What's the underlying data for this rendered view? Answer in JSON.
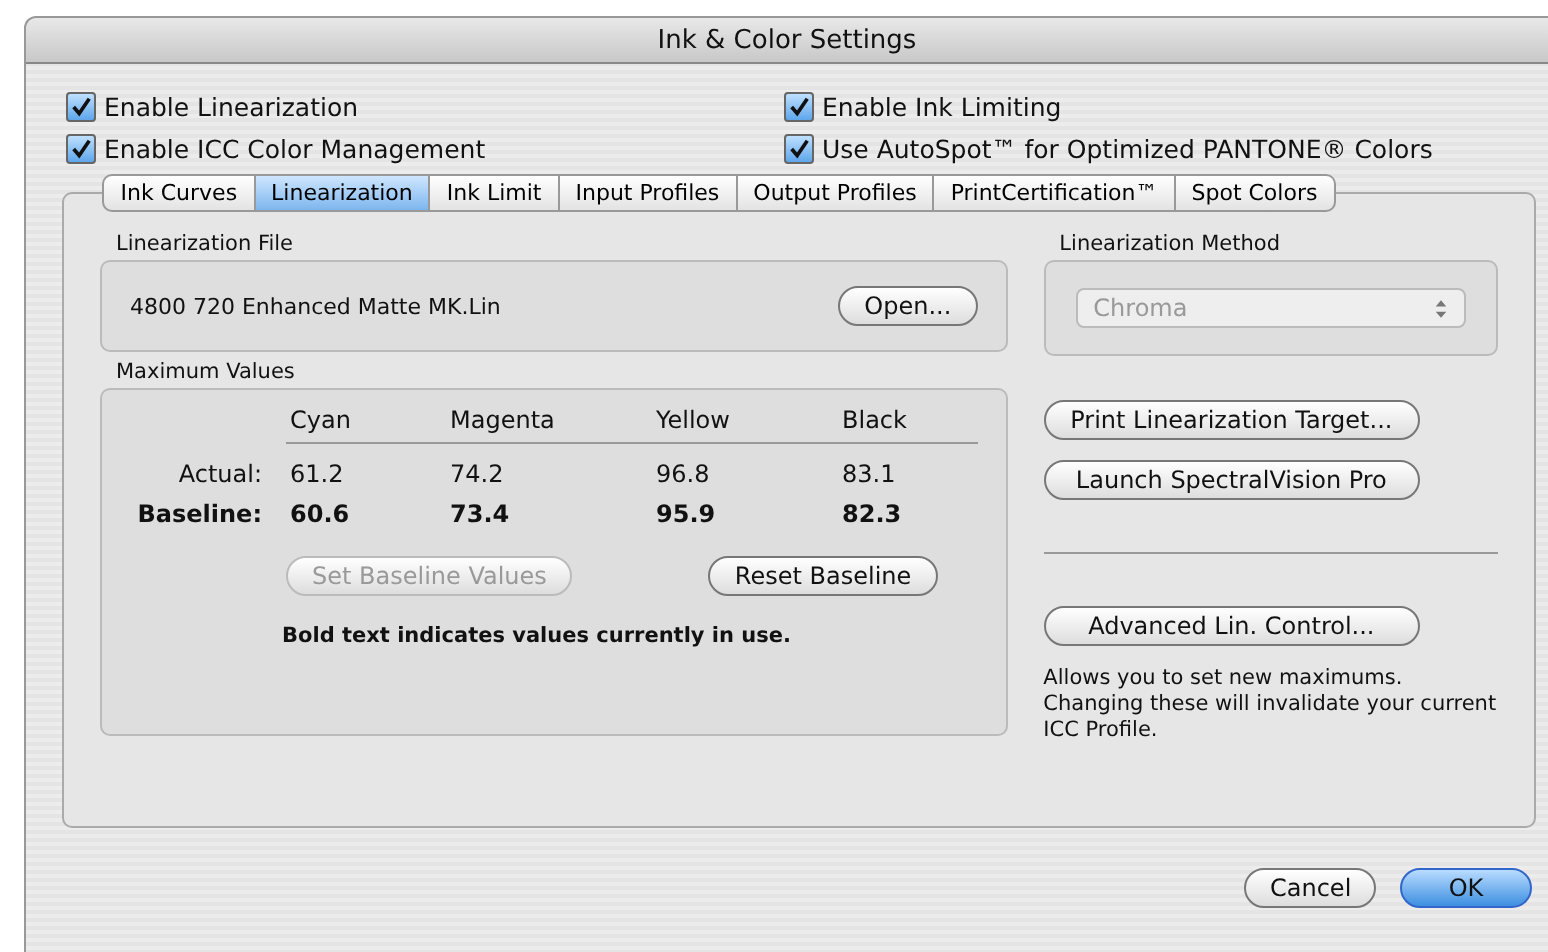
{
  "window": {
    "title": "Ink & Color Settings"
  },
  "options": [
    {
      "label": "Enable Linearization",
      "checked": true
    },
    {
      "label": "Enable Ink Limiting",
      "checked": true
    },
    {
      "label": "Enable ICC Color Management",
      "checked": true
    },
    {
      "label": "Use AutoSpot™ for Optimized PANTONE® Colors",
      "checked": true
    }
  ],
  "tabs": [
    {
      "label": "Ink Curves",
      "selected": false
    },
    {
      "label": "Linearization",
      "selected": true
    },
    {
      "label": "Ink Limit",
      "selected": false
    },
    {
      "label": "Input Profiles",
      "selected": false
    },
    {
      "label": "Output Profiles",
      "selected": false
    },
    {
      "label": "PrintCertification™",
      "selected": false
    },
    {
      "label": "Spot Colors",
      "selected": false
    }
  ],
  "linearization_file": {
    "heading": "Linearization File",
    "file": "4800 720 Enhanced Matte MK.Lin",
    "button": {
      "label": "Open..."
    }
  },
  "maximum_values": {
    "heading": "Maximum Values",
    "columns": [
      "Cyan",
      "Magenta",
      "Yellow",
      "Black"
    ],
    "rows": [
      {
        "label": "Actual:",
        "bold": false,
        "values": [
          "61.2",
          "74.2",
          "96.8",
          "83.1"
        ]
      },
      {
        "label": "Baseline:",
        "bold": true,
        "values": [
          "60.6",
          "73.4",
          "95.9",
          "82.3"
        ]
      }
    ],
    "buttons": [
      {
        "label": "Set Baseline Values",
        "disabled": true
      },
      {
        "label": "Reset Baseline",
        "disabled": false
      }
    ],
    "note": "Bold text indicates values currently in use."
  },
  "linearization_method": {
    "heading": "Linearization Method",
    "value": "Chroma",
    "disabled": true
  },
  "actions": [
    {
      "label": "Print Linearization Target...",
      "disabled": false
    },
    {
      "label": "Launch SpectralVision Pro",
      "disabled": false
    }
  ],
  "advanced": {
    "button": {
      "label": "Advanced Lin. Control..."
    },
    "note": "Allows you to set new maximums. Changing these will invalidate your current ICC Profile."
  },
  "buttons": [
    {
      "label": "Cancel",
      "default": false
    },
    {
      "label": "OK",
      "default": true
    }
  ]
}
